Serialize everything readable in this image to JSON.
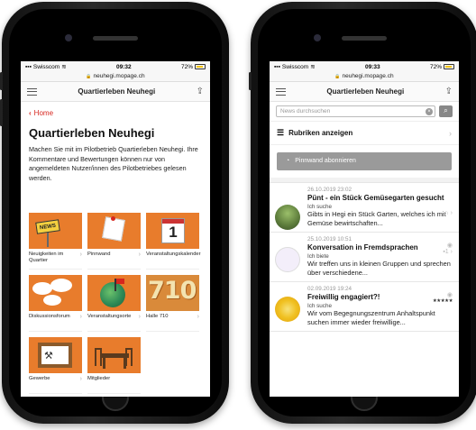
{
  "left_screen": {
    "status": {
      "carrier": "Swisscom",
      "time": "09:32",
      "battery": "72%"
    },
    "url": "neuhegi.mopage.ch",
    "header_title": "Quartierleben Neuhegi",
    "back_label": "Home",
    "page_title": "Quartierleben Neuhegi",
    "intro": "Machen Sie mit im Pilotbetrieb Quartierleben Neuhegi. Ihre Kommentare und Bewertungen können nur von angemeldeten Nutzer/innen des Pilotbetriebes gelesen werden.",
    "tiles": [
      {
        "label": "Neuigkeiten im Quartier",
        "icon": "news-sign-icon",
        "sign_text": "NEWS"
      },
      {
        "label": "Pinnwand",
        "icon": "pinboard-note-icon"
      },
      {
        "label": "Veranstaltungskalender",
        "icon": "calendar-icon",
        "day": "1"
      },
      {
        "label": "Diskussionsforum",
        "icon": "speech-bubbles-icon"
      },
      {
        "label": "Veranstaltungsorte",
        "icon": "globe-flag-icon"
      },
      {
        "label": "Halle 710",
        "icon": "hall-710-icon",
        "number": "710"
      },
      {
        "label": "Gewerbe",
        "icon": "tools-frame-icon"
      },
      {
        "label": "Mitglieder",
        "icon": "table-chairs-icon"
      }
    ]
  },
  "right_screen": {
    "status": {
      "carrier": "Swisscom",
      "time": "09:33",
      "battery": "72%"
    },
    "url": "neuhegi.mopage.ch",
    "header_title": "Quartierleben Neuhegi",
    "search_placeholder": "News durchsuchen",
    "rubriken_label": "Rubriken anzeigen",
    "subscribe_label": "Pinnwand abonnieren",
    "entries": [
      {
        "date": "26.10.2019 23:02",
        "title": "Pünt - ein Stück Gemüsegarten gesucht",
        "type": "Ich suche",
        "text": "Gibts in Hegi ein Stück Garten, welches ich mit Gemüse bewirtschaften...",
        "thumb_color": "#5b7a3a"
      },
      {
        "date": "25.10.2019 10:51",
        "title": "Konversation in Fremdsprachen",
        "type": "Ich biete",
        "text": "Wir treffen uns in kleinen Gruppen und sprechen über verschiedene...",
        "comments": "1",
        "thumb_color": "#e9e4f2"
      },
      {
        "date": "02.09.2019 19:24",
        "title": "Freiwillig engagiert?!",
        "type": "Ich suche",
        "text": "Wir vom Begegnungszentrum Anhaltspunkt suchen immer wieder freiwillige...",
        "rating": "★★★★★",
        "thumb_color": "#f0c020"
      }
    ]
  }
}
